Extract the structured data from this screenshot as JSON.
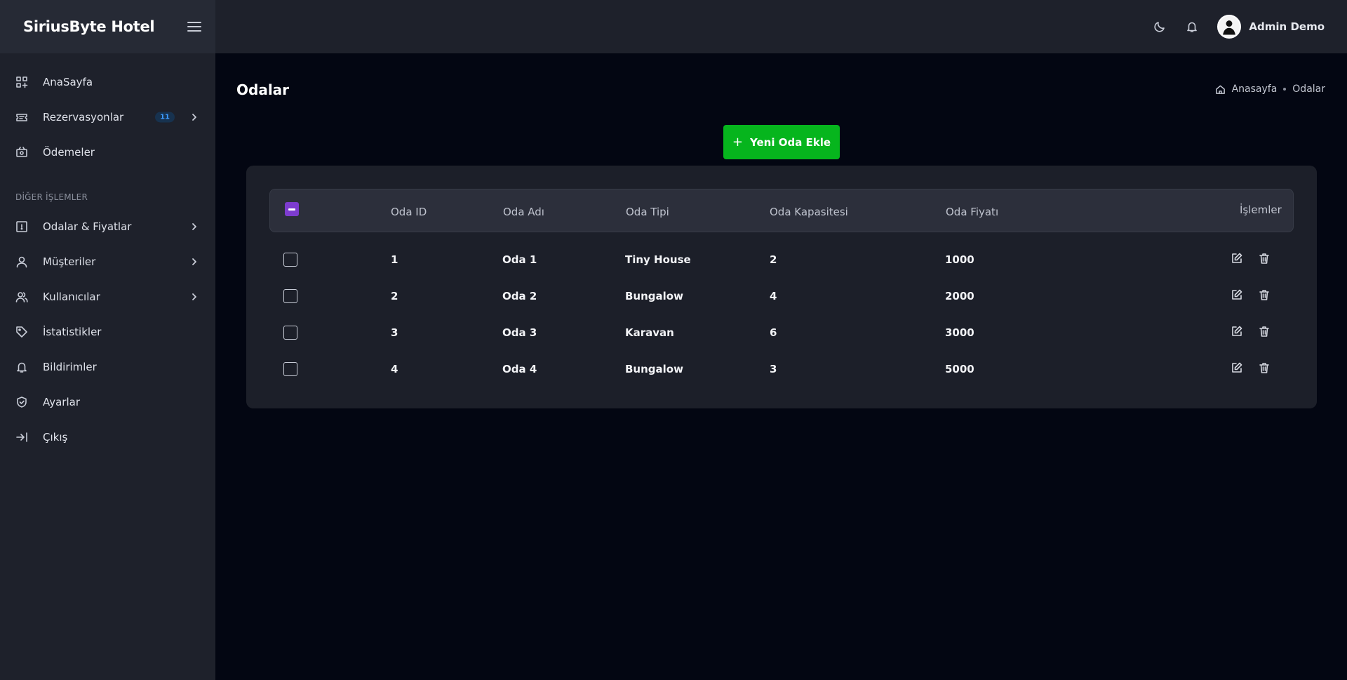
{
  "brand": {
    "title": "SiriusByte Hotel"
  },
  "sidebar": {
    "items": [
      {
        "label": "AnaSayfa",
        "icon": "dashboard-icon"
      },
      {
        "label": "Rezervasyonlar",
        "icon": "ticket-icon",
        "badge": "11"
      },
      {
        "label": "Ödemeler",
        "icon": "cash-icon"
      }
    ],
    "section_label": "DİĞER İŞLEMLER",
    "other_items": [
      {
        "label": "Odalar & Fiyatlar",
        "icon": "door-icon"
      },
      {
        "label": "Müşteriler",
        "icon": "user-icon"
      },
      {
        "label": "Kullanıcılar",
        "icon": "users-icon"
      },
      {
        "label": "İstatistikler",
        "icon": "tag-icon"
      },
      {
        "label": "Bildirimler",
        "icon": "bell-icon"
      },
      {
        "label": "Ayarlar",
        "icon": "shield-icon"
      },
      {
        "label": "Çıkış",
        "icon": "logout-icon"
      }
    ]
  },
  "topbar": {
    "user_name": "Admin Demo"
  },
  "page": {
    "title": "Odalar",
    "breadcrumb": {
      "home": "Anasayfa",
      "current": "Odalar"
    },
    "add_button": "Yeni Oda Ekle"
  },
  "table": {
    "headers": {
      "id": "Oda ID",
      "name": "Oda Adı",
      "type": "Oda Tipi",
      "capacity": "Oda Kapasitesi",
      "price": "Oda Fiyatı",
      "actions": "İşlemler"
    },
    "rows": [
      {
        "id": "1",
        "name": "Oda 1",
        "type": "Tiny House",
        "capacity": "2",
        "price": "1000"
      },
      {
        "id": "2",
        "name": "Oda 2",
        "type": "Bungalow",
        "capacity": "4",
        "price": "2000"
      },
      {
        "id": "3",
        "name": "Oda 3",
        "type": "Karavan",
        "capacity": "6",
        "price": "3000"
      },
      {
        "id": "4",
        "name": "Oda 4",
        "type": "Bungalow",
        "capacity": "3",
        "price": "5000"
      }
    ]
  },
  "colors": {
    "accent_green": "#06b51d",
    "checkbox_purple": "#7d3ccf",
    "badge_blue": "#3d9bff"
  }
}
